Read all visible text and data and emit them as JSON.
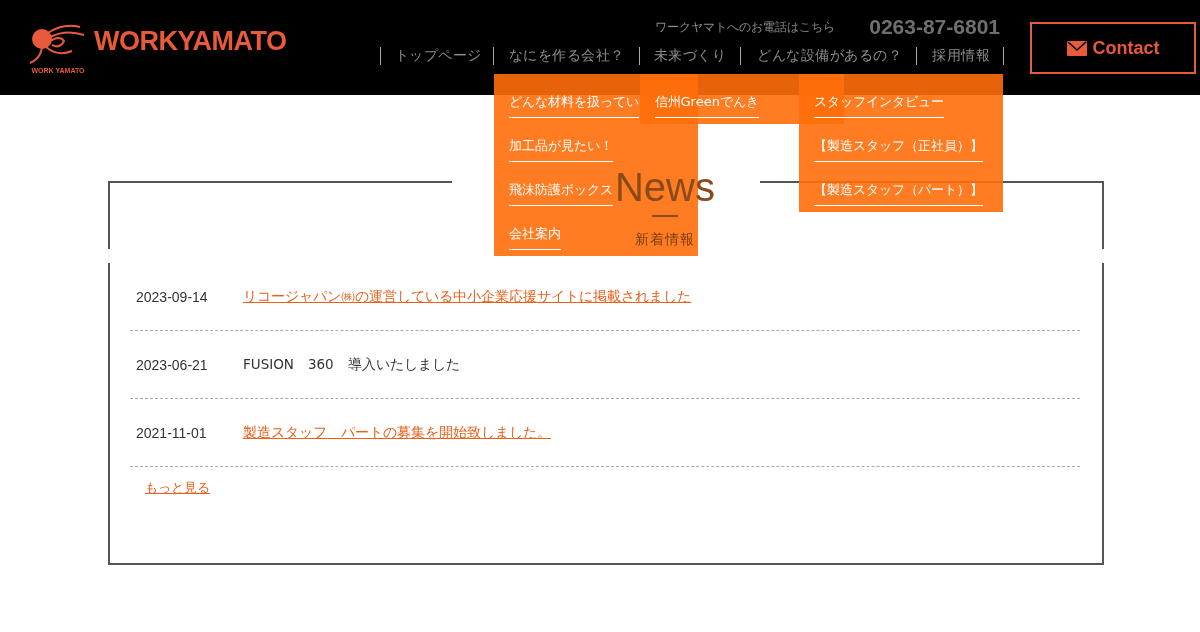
{
  "header": {
    "logo": {
      "mark_caption": "WORK YAMATO",
      "wordmark": "WORKYAMATO"
    },
    "phone": {
      "label": "ワークヤマトへのお電話はこちら",
      "number": "0263-87-6801"
    },
    "contact_button": "Contact",
    "nav": [
      {
        "label": "トップページ"
      },
      {
        "label": "なにを作る会社？",
        "submenu": [
          "どんな材料を扱ってい",
          "加工品が見たい！",
          "飛沫防護ボックス",
          "会社案内"
        ]
      },
      {
        "label": "未来づくり",
        "submenu": [
          "信州Greenでんき"
        ]
      },
      {
        "label": "どんな設備があるの？"
      },
      {
        "label": "採用情報",
        "submenu": [
          "スタッフインタビュー",
          "【製造スタッフ（正社員）】",
          "【製造スタッフ（パート）】"
        ]
      }
    ]
  },
  "news": {
    "title": "News",
    "subtitle": "新着情報",
    "items": [
      {
        "date": "2023-09-14",
        "text": "リコージャパン㈱の運営している中小企業応援サイトに掲載されました",
        "kind": "link"
      },
      {
        "date": "2023-06-21",
        "text": "FUSION　360　導入いたしました",
        "kind": "text"
      },
      {
        "date": "2021-11-01",
        "text": "製造スタッフ　パートの募集を開始致しました。",
        "kind": "link"
      }
    ],
    "more_link": "もっと見る"
  }
}
